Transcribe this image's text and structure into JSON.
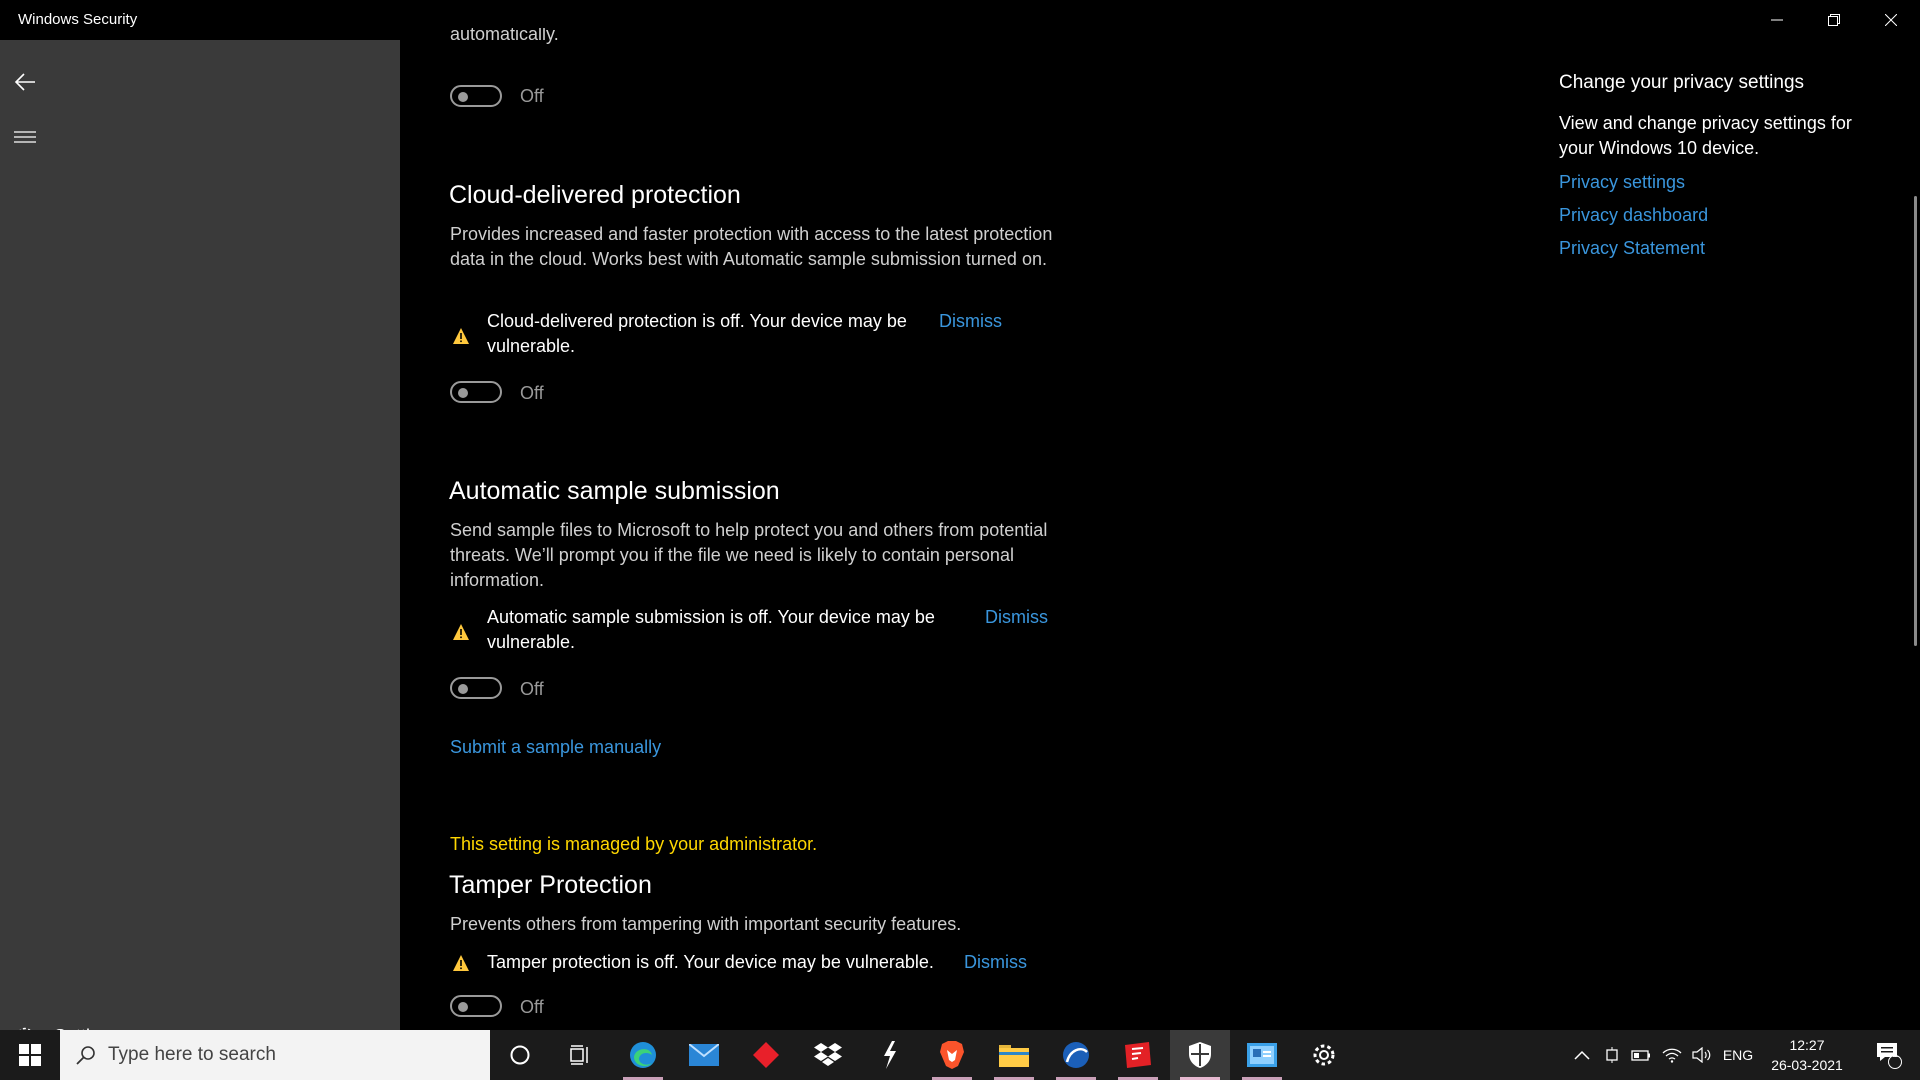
{
  "window": {
    "title": "Windows Security",
    "controls": {
      "minimize": "minimize",
      "restore": "restore",
      "close": "close"
    }
  },
  "sidebar": {
    "back_icon": "back-arrow-icon",
    "menu_icon": "hamburger-menu-icon",
    "settings_label": "Settings"
  },
  "main": {
    "top_fragment": "automatically.",
    "top_toggle": {
      "state": "Off"
    },
    "sections": [
      {
        "title": "Cloud-delivered protection",
        "description": "Provides increased and faster protection with access to the latest protection data in the cloud. Works best with Automatic sample submission turned on.",
        "warning_line1": "Cloud-delivered protection is off. Your device may be",
        "warning_line2": "vulnerable.",
        "dismiss": "Dismiss",
        "toggle_state": "Off"
      },
      {
        "title": "Automatic sample submission",
        "description": "Send sample files to Microsoft to help protect you and others from potential threats. We’ll prompt you if the file we need is likely to contain personal information.",
        "warning_line1": "Automatic sample submission is off. Your device may be",
        "warning_line2": "vulnerable.",
        "dismiss": "Dismiss",
        "toggle_state": "Off",
        "link": "Submit a sample manually"
      },
      {
        "admin_note": "This setting is managed by your administrator.",
        "title": "Tamper Protection",
        "description": "Prevents others from tampering with important security features.",
        "warning_line1": "Tamper protection is off. Your device may be vulnerable.",
        "dismiss": "Dismiss",
        "toggle_state": "Off"
      }
    ]
  },
  "privacy_panel": {
    "heading": "Change your privacy settings",
    "description": "View and change privacy settings for your Windows 10 device.",
    "links": [
      "Privacy settings",
      "Privacy dashboard",
      "Privacy Statement"
    ]
  },
  "taskbar": {
    "search_placeholder": "Type here to search",
    "apps": [
      "cortana",
      "task-view",
      "edge",
      "mail",
      "red-app",
      "dropbox",
      "winamp-like",
      "brave",
      "file-explorer",
      "browser-arc",
      "pdf-app",
      "windows-security",
      "control-panel",
      "settings"
    ],
    "tray": {
      "language": "ENG",
      "time": "12:27",
      "date": "26-03-2021",
      "notification_count": "1"
    }
  },
  "colors": {
    "accent_link": "#3a96dd",
    "warning": "#ffc83d",
    "admin_note": "#ffd700",
    "sidebar_bg": "#3a3a3a"
  }
}
